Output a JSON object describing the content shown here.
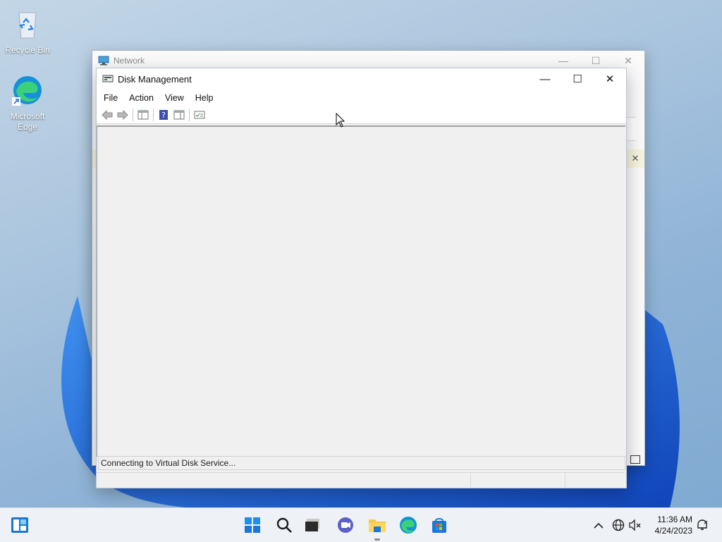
{
  "desktop": {
    "icons": [
      {
        "label": "Recycle Bin",
        "icon": "recycle-bin-icon"
      },
      {
        "label": "Microsoft Edge",
        "label_lines": [
          "Microsoft",
          "Edge"
        ],
        "icon": "edge-icon"
      }
    ]
  },
  "background_window": {
    "title": "Network",
    "controls": {
      "minimize": "—",
      "maximize": "☐",
      "close": "✕"
    },
    "infobar_close": "✕"
  },
  "disk_management": {
    "title": "Disk Management",
    "controls": {
      "minimize": "—",
      "maximize": "☐",
      "close": "✕"
    },
    "menu": [
      "File",
      "Action",
      "View",
      "Help"
    ],
    "toolbar": [
      "back-icon",
      "forward-icon",
      "show-hide-console-tree-icon",
      "help-icon",
      "show-hide-action-pane-icon",
      "properties-icon"
    ],
    "status": "Connecting to Virtual Disk Service..."
  },
  "taskbar": {
    "widgets_icon": "widgets-icon",
    "pinned": [
      "start-icon",
      "search-icon",
      "task-view-icon",
      "chat-icon",
      "file-explorer-icon",
      "edge-icon",
      "store-icon"
    ],
    "tray": [
      "show-hidden-icons-icon",
      "network-icon",
      "volume-muted-icon",
      "notification-icon"
    ],
    "time": "11:36 AM",
    "date": "4/24/2023"
  },
  "colors": {
    "accent": "#0067c0",
    "windows_blue": "#1a6fe0"
  }
}
